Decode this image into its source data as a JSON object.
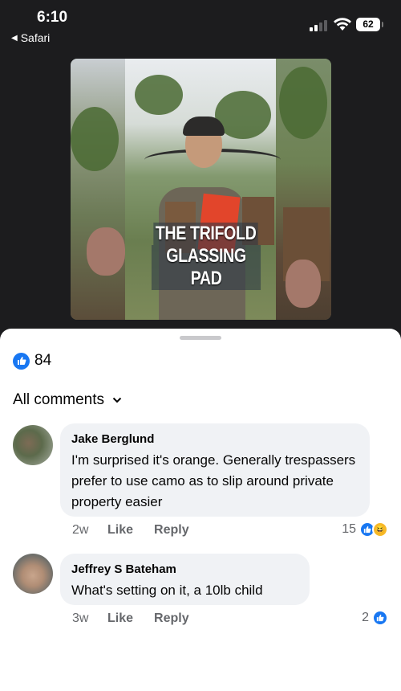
{
  "status": {
    "time": "6:10",
    "back_app": "Safari",
    "battery": "62"
  },
  "video": {
    "caption_lines": [
      "THE TRIFOLD",
      "GLASSING PAD"
    ]
  },
  "reactions_bar": {
    "count": "84"
  },
  "comments_header": {
    "label": "All comments"
  },
  "comments": [
    {
      "author": "Jake Berglund",
      "text": "I'm surprised it's orange. Generally trespassers prefer to use camo as to slip around private property easier",
      "time": "2w",
      "like_label": "Like",
      "reply_label": "Reply",
      "reaction_count": "15",
      "reaction_icons": [
        "like-icon",
        "haha-icon"
      ]
    },
    {
      "author": "Jeffrey S Bateham",
      "text": "What's setting on it, a 10lb child",
      "time": "3w",
      "like_label": "Like",
      "reply_label": "Reply",
      "reaction_count": "2",
      "reaction_icons": [
        "like-icon"
      ]
    }
  ],
  "colors": {
    "accent": "#1877f2",
    "haha": "#f7b928",
    "bubble": "#f0f2f5",
    "muted": "#65676b"
  }
}
